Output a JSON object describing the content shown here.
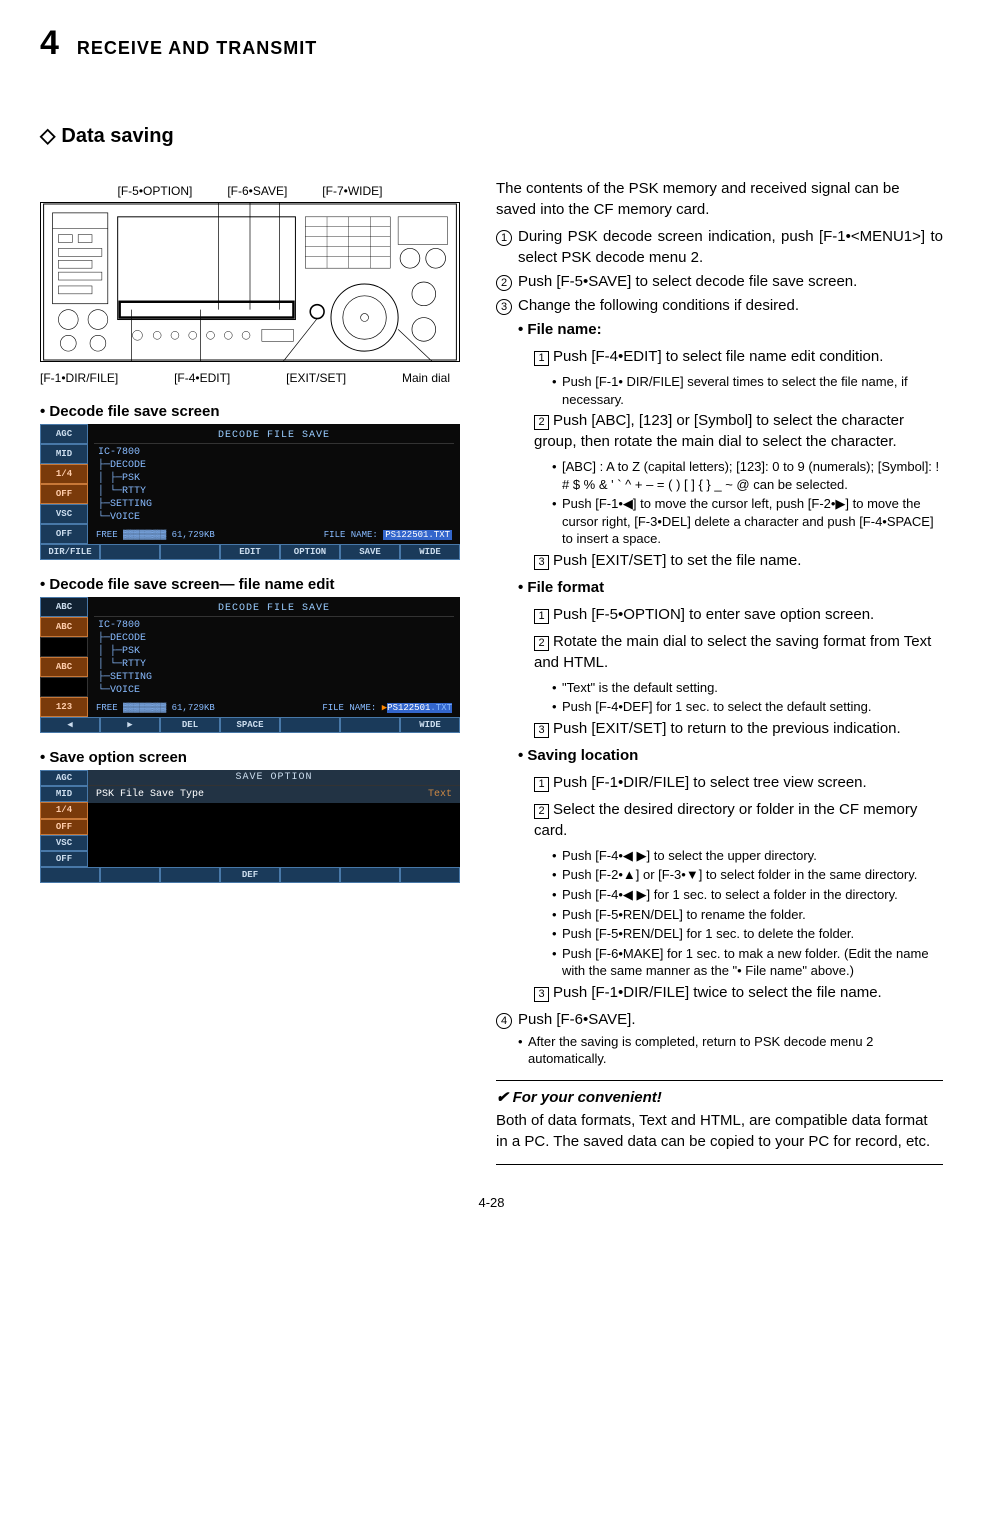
{
  "header": {
    "chapter_num": "4",
    "chapter_title": "RECEIVE AND TRANSMIT"
  },
  "section": {
    "title": "Data saving"
  },
  "diagram": {
    "top_labels": [
      "[F-5•OPTION]",
      "[F-6•SAVE]",
      "[F-7•WIDE]"
    ],
    "bottom_labels": [
      "[F-1•DIR/FILE]",
      "[F-4•EDIT]",
      "[EXIT/SET]",
      "Main dial"
    ]
  },
  "screens": {
    "decode_save": {
      "heading": "• Decode file save screen",
      "title_bar": "DECODE FILE SAVE",
      "side": [
        "AGC",
        "MID",
        "1/4",
        "OFF",
        "VSC",
        "OFF"
      ],
      "tree": [
        "IC-7800",
        "├─DECODE",
        "│  ├─PSK",
        "│  └─RTTY",
        "├─SETTING",
        "└─VOICE"
      ],
      "status_left": "FREE",
      "status_kb": "61,729KB",
      "status_file": "FILE NAME:",
      "status_name": "PS122501.TXT",
      "f_row": [
        "DIR/FILE",
        "",
        "",
        "EDIT",
        "OPTION",
        "SAVE",
        "WIDE"
      ]
    },
    "name_edit": {
      "heading": "• Decode file save screen— file name edit",
      "title_bar": "DECODE FILE SAVE",
      "side": [
        "",
        "ABC",
        "",
        "ABC",
        "",
        "123"
      ],
      "tree": [
        "IC-7800",
        "├─DECODE",
        "│  ├─PSK",
        "│  └─RTTY",
        "├─SETTING",
        "└─VOICE"
      ],
      "status_left": "FREE",
      "status_kb": "61,729KB",
      "status_file": "FILE NAME:",
      "status_name_pre": "PS122501",
      "status_name_ext": ".TXT",
      "f_row": [
        "◀",
        "▶",
        "DEL",
        "SPACE",
        "",
        "",
        "WIDE"
      ]
    },
    "save_option": {
      "heading": "• Save option screen",
      "title_bar": "SAVE OPTION",
      "side": [
        "AGC",
        "MID",
        "1/4",
        "OFF",
        "VSC",
        "OFF"
      ],
      "row_label": "PSK File Save Type",
      "row_value": "Text",
      "f_row": [
        "",
        "",
        "",
        "DEF",
        "",
        "",
        ""
      ]
    }
  },
  "body": {
    "intro": "The contents of the PSK memory and received signal can be saved into the CF memory card.",
    "steps": [
      {
        "n": "1",
        "t": "During PSK decode screen indication, push [F-1•<MENU1>] to select PSK decode menu 2."
      },
      {
        "n": "2",
        "t": "Push [F-5•SAVE] to select decode file save screen."
      },
      {
        "n": "3",
        "t": "Change the following conditions if desired."
      }
    ],
    "filename_h": "• File name:",
    "filename": {
      "b1": "Push [F-4•EDIT] to select file name edit condition.",
      "b1a": "Push [F-1• DIR/FILE] several times to select the file name, if necessary.",
      "b2": "Push [ABC], [123] or [Symbol] to select the character group, then rotate the main dial to select the character.",
      "b2a": "[ABC] : A to Z (capital letters); [123]: 0 to 9 (numerals); [Symbol]: ! # $ % & ' ` ^ + – = ( ) [ ] { } _ ~ @ can be selected.",
      "b2b": "Push [F-1•◀] to move the cursor left, push [F-2•▶] to move the cursor right, [F-3•DEL] delete a character and push [F-4•SPACE] to insert a space.",
      "b3": "Push [EXIT/SET] to set the file name."
    },
    "format_h": "• File format",
    "format": {
      "b1": "Push [F-5•OPTION] to enter save option screen.",
      "b2": "Rotate the main dial to select the saving format from Text and HTML.",
      "b2a": "\"Text\" is the default setting.",
      "b2b": "Push [F-4•DEF] for 1 sec. to select the default setting.",
      "b3": "Push [EXIT/SET] to return to the previous indication."
    },
    "location_h": "• Saving location",
    "location": {
      "b1": "Push [F-1•DIR/FILE] to select tree view screen.",
      "b2": "Select the desired directory or folder in the CF memory card.",
      "b2a": "Push [F-4•◀ ▶] to select the upper directory.",
      "b2b": "Push [F-2•▲] or [F-3•▼] to select folder in the same directory.",
      "b2c": "Push [F-4•◀ ▶] for 1 sec. to select a folder in the directory.",
      "b2d": "Push [F-5•REN/DEL] to rename the folder.",
      "b2e": "Push [F-5•REN/DEL] for 1 sec. to delete the folder.",
      "b2f": "Push [F-6•MAKE] for 1 sec. to mak a new folder. (Edit the name with the same manner as the \"• File name\" above.)",
      "b3": "Push [F-1•DIR/FILE] twice to select the file name."
    },
    "step4": "Push [F-6•SAVE].",
    "step4a": "After the saving is completed, return to PSK decode menu 2 automatically.",
    "tip_h": "For your convenient!",
    "tip": "Both of data formats, Text and HTML, are compatible data format in a PC. The saved data can be copied to your PC for record, etc."
  },
  "page_num": "4-28"
}
